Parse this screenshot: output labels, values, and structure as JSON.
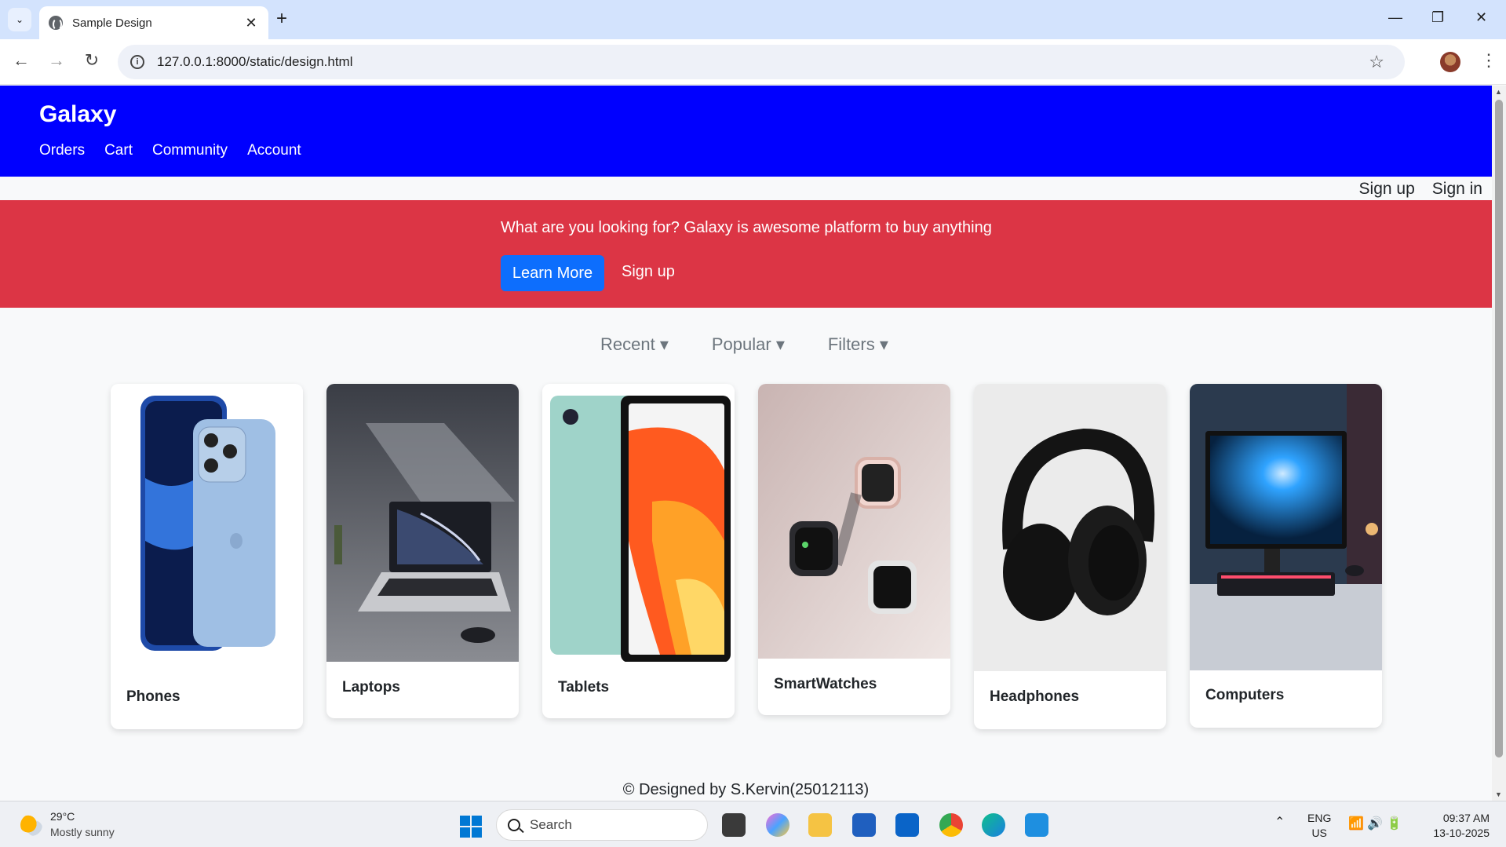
{
  "browser": {
    "tab_title": "Sample Design",
    "url": "127.0.0.1:8000/static/design.html",
    "new_tab": "+",
    "tab_close": "✕",
    "tab_menu": "⌄",
    "minimize": "—",
    "restore": "❐",
    "close": "✕"
  },
  "site": {
    "brand": "Galaxy",
    "nav": [
      "Orders",
      "Cart",
      "Community",
      "Account"
    ],
    "auth": {
      "signup": "Sign up",
      "signin": "Sign in"
    },
    "hero": {
      "text": "What are you looking for? Galaxy is awesome platform to buy anything",
      "learn_more": "Learn More",
      "signup": "Sign up"
    },
    "filters": [
      "Recent ▾",
      "Popular ▾",
      "Filters ▾"
    ],
    "categories": [
      "Phones",
      "Laptops",
      "Tablets",
      "SmartWatches",
      "Headphones",
      "Computers"
    ],
    "footer": "© Designed by S.Kervin(25012113)"
  },
  "taskbar": {
    "temp": "29°C",
    "weather": "Mostly sunny",
    "search": "Search",
    "lang_top": "ENG",
    "lang_bottom": "US",
    "time": "09:37 AM",
    "date": "13-10-2025"
  },
  "colors": {
    "header": "#0000ff",
    "hero": "#dc3545",
    "primary_button": "#0d6efd"
  }
}
